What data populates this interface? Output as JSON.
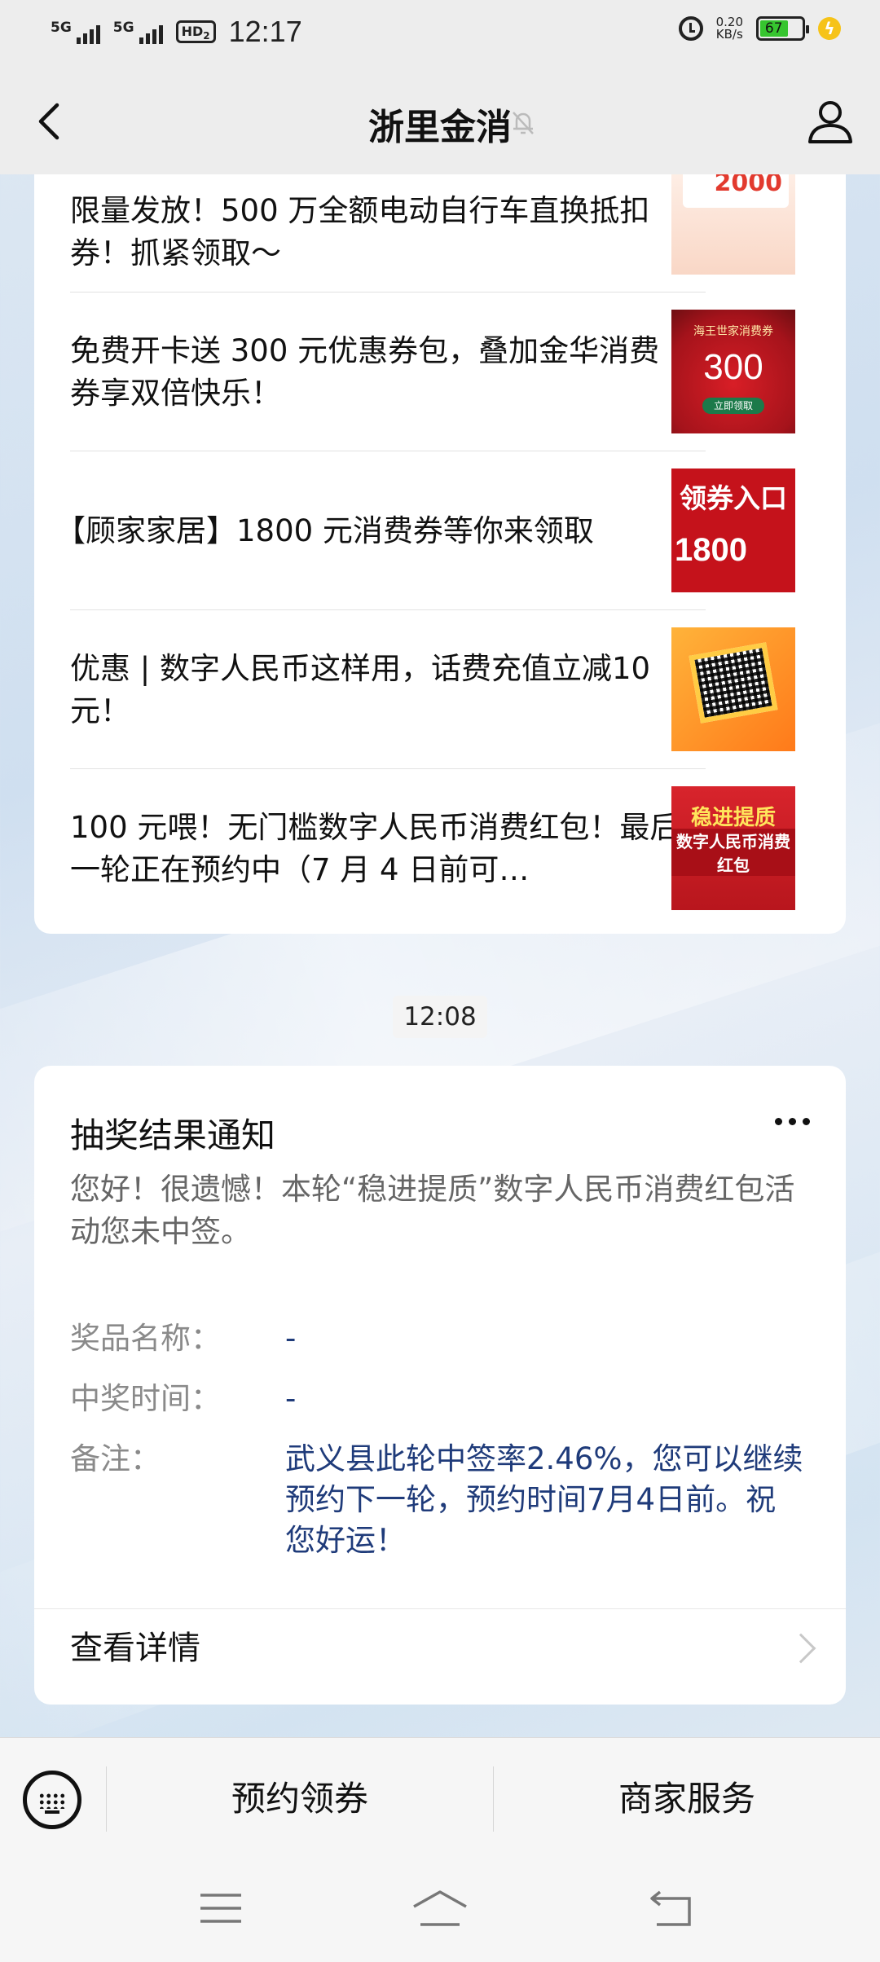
{
  "status_bar": {
    "network_1": "5G",
    "network_2": "5G",
    "hd_badge": "HD",
    "hd_sub": "2",
    "time": "12:17",
    "speed_value": "0.20",
    "speed_unit": "KB/s",
    "battery_level": "67",
    "icons": [
      "signal-icon",
      "alarm-icon",
      "battery-icon",
      "charging-icon"
    ]
  },
  "nav": {
    "title": "浙里金消",
    "icons": [
      "back-arrow-icon",
      "mute-bell-icon",
      "profile-icon"
    ]
  },
  "articles": [
    {
      "text": "限量发放！500 万全额电动自行车直换抵扣券！抓紧领取～",
      "thumb_text": "2000"
    },
    {
      "text": "免费开卡送 300 元优惠券包，叠加金华消费券享双倍快乐！",
      "thumb_top": "海王世家消费券",
      "thumb_big": "300",
      "thumb_pill": "立即领取"
    },
    {
      "text": "【顾家家居】1800 元消费券等你来领取",
      "thumb_top": "领券入口",
      "thumb_big": "1800"
    },
    {
      "text": "优惠 | 数字人民币这样用，话费充值立减10 元！"
    },
    {
      "text": "100 元喂！无门槛数字人民币消费红包！最后一轮正在预约中（7 月 4 日前可…",
      "thumb_title": "稳进提质",
      "thumb_sub": "数字人民币消费红包"
    }
  ],
  "timestamp": "12:08",
  "notice": {
    "title": "抽奖结果通知",
    "body": "您好！很遗憾！本轮“稳进提质”数字人民币消费红包活动您未中签。",
    "fields": [
      {
        "key": "奖品名称：",
        "value": "-"
      },
      {
        "key": "中奖时间：",
        "value": "-"
      },
      {
        "key": "备注：",
        "value": "武义县此轮中签率2.46%，您可以继续预约下一轮，预约时间7月4日前。祝您好运！"
      }
    ],
    "detail_label": "查看详情"
  },
  "bottom_menu": {
    "items": [
      "预约领券",
      "商家服务"
    ],
    "keyboard_icon": "keyboard-icon"
  },
  "system_nav": {
    "icons": [
      "menu-icon",
      "home-icon",
      "back-icon"
    ]
  },
  "colors": {
    "accent_text": "#1f3b7a",
    "bar_background": "#ededed",
    "card_background": "#ffffff"
  }
}
